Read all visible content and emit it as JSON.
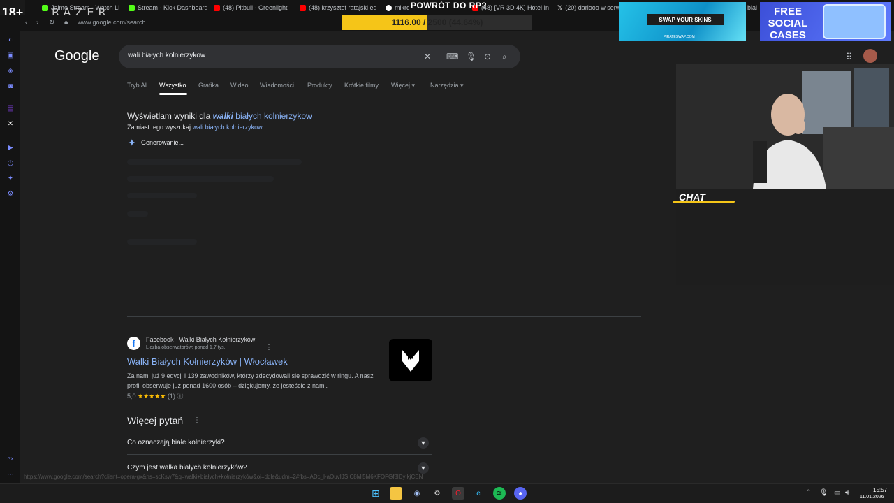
{
  "browser": {
    "age_badge": "18+",
    "brand": "RAZER",
    "url": "www.google.com/search",
    "tabs": [
      {
        "label": "Jaime Stream - Watch Li",
        "color": "#53fc18"
      },
      {
        "label": "Stream - Kick Dashboard",
        "color": "#53fc18"
      },
      {
        "label": "(48) Pitbull - Greenlight",
        "color": "#ff0000"
      },
      {
        "label": "(48) krzysztof ratajski ed",
        "color": "#ff0000"
      },
      {
        "label": "mikro",
        "color": "#ffffff"
      },
      {
        "label": "(48) [VR 3D 4K] Hotel In",
        "color": "#ff0000"
      },
      {
        "label": "(20) darlooo w serw",
        "color": "#ffffff"
      },
      {
        "label": "bial",
        "color": "#ffffff"
      }
    ]
  },
  "goal": {
    "title": "POWRÓT DO RP?",
    "progress_text": "1116.00 / 2500 (44.64%)",
    "current": 1116,
    "target": 2500
  },
  "ads": {
    "ad1_button": "SWAP YOUR SKINS",
    "ad1_site": "PIRATESWAP.COM",
    "ad2_text": "FREE SOCIAL CASES"
  },
  "google": {
    "logo": "Google",
    "query": "wali białych kolnierzykow",
    "tabs": [
      "Tryb AI",
      "Wszystko",
      "Grafika",
      "Wideo",
      "Wiadomości",
      "Produkty",
      "Krótkie filmy",
      "Więcej",
      "Narzędzia"
    ],
    "active_tab": "Wszystko",
    "spell": {
      "prefix": "Wyświetlam wyniki dla",
      "corrected_bold": "walki",
      "corrected_rest": "białych kolnierzykow",
      "instead_prefix": "Zamiast tego wyszukaj",
      "instead_link": "wali białych kolnierzykow"
    },
    "ai_status": "Generowanie...",
    "result": {
      "site": "Facebook · Walki Białych Kołnierzyków",
      "sub": "Liczba obserwatorów: ponad 1,7 tys.",
      "title": "Walki Białych Kołnierzyków | Włocławek",
      "snippet": "Za nami już 9 edycji i 139 zawodników, którzy zdecydowali się sprawdzić w ringu. A nasz profil obserwuje już ponad 1600 osób – dziękujemy, że jesteście z nami.",
      "rating_value": "5,0",
      "stars": "★★★★★",
      "rating_count": "(1)"
    },
    "paa": {
      "title": "Więcej pytań",
      "questions": [
        "Co oznaczają białe kołnierzyki?",
        "Czym jest walka białych kołnierzyków?"
      ]
    },
    "status_url": "https://www.google.com/search?client=opera-gx&hs=scKsw7&q=walki+białych+kołnierzyków&oi=ddle&udm=2#fbs=ADc_l-aOuvIJSIC8Mi5M6KFOFGf8lDyIkjCEN"
  },
  "overlay": {
    "chat_label": "CHAT"
  },
  "taskbar": {
    "time": "15:57",
    "date": "11.01.2026"
  },
  "icons": [
    "search-icon",
    "mic-icon",
    "keyboard-icon",
    "lens-icon",
    "clear-icon",
    "apps-icon",
    "reload-icon",
    "back-icon",
    "lock-icon",
    "sparkle-icon",
    "facebook-icon",
    "chevron-down-icon",
    "more-icon",
    "windows-icon"
  ]
}
